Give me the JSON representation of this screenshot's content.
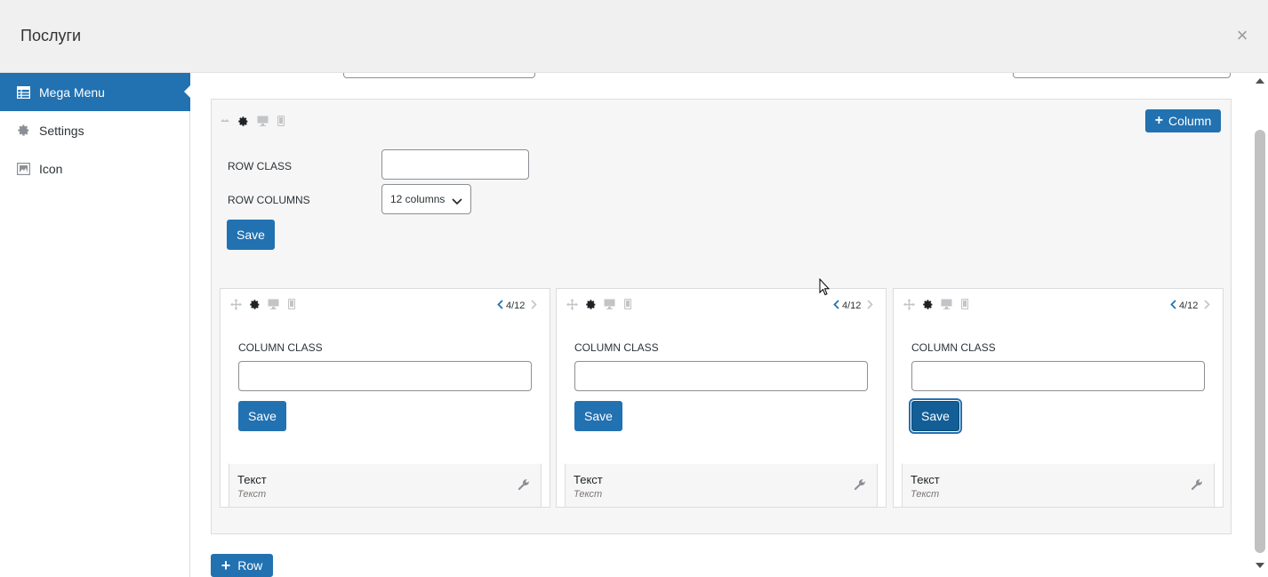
{
  "modal": {
    "title": "Послуги",
    "close_glyph": "×"
  },
  "sidebar": {
    "items": [
      {
        "label": "Mega Menu",
        "icon": "table-icon",
        "active": true
      },
      {
        "label": "Settings",
        "icon": "gear-icon",
        "active": false
      },
      {
        "label": "Icon",
        "icon": "image-icon",
        "active": false
      }
    ]
  },
  "row": {
    "add_column_label": "Column",
    "class_label": "ROW CLASS",
    "class_value": "",
    "columns_label": "ROW COLUMNS",
    "columns_selected": "12 columns",
    "save_label": "Save"
  },
  "columns": [
    {
      "width": "4/12",
      "class_label": "COLUMN CLASS",
      "class_value": "",
      "save_label": "Save",
      "widget_title": "Текст",
      "widget_sub": "Текст"
    },
    {
      "width": "4/12",
      "class_label": "COLUMN CLASS",
      "class_value": "",
      "save_label": "Save",
      "widget_title": "Текст",
      "widget_sub": "Текст"
    },
    {
      "width": "4/12",
      "class_label": "COLUMN CLASS",
      "class_value": "",
      "save_label": "Save",
      "widget_title": "Текст",
      "widget_sub": "Текст"
    }
  ],
  "add_row_label": "Row",
  "colors": {
    "primary": "#2271b1",
    "primary_dark": "#135e96",
    "panel_bg": "#f6f6f6"
  }
}
